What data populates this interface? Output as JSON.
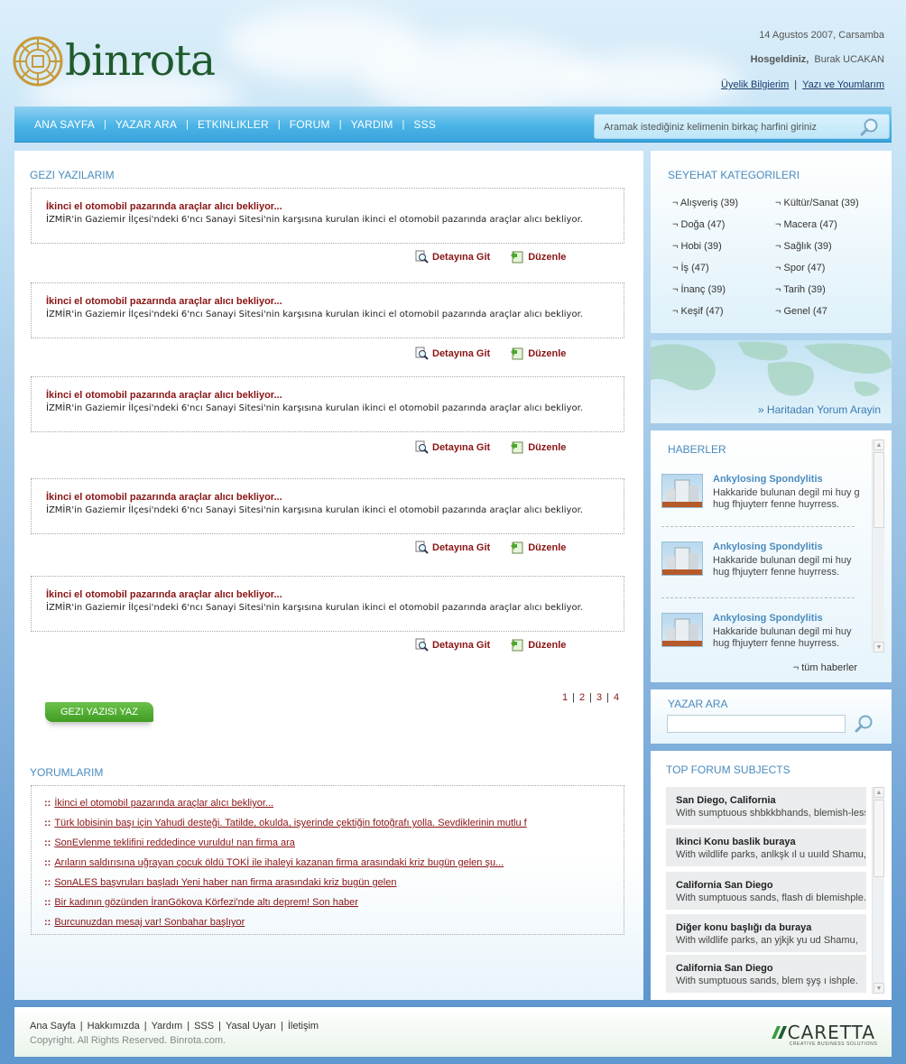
{
  "header": {
    "brand": "binrota",
    "date": "14 Agustos 2007, Carsamba",
    "welcome_label": "Hosgeldiniz,",
    "user_name": "Burak UCAKAN",
    "account_link": "Üyelik Bilgierim",
    "posts_link": "Yazı ve Youmlarım"
  },
  "nav": {
    "items": [
      "ANA SAYFA",
      "YAZAR ARA",
      "ETKINLIKLER",
      "FORUM",
      "YARDIM",
      "SSS"
    ],
    "search_placeholder": "Aramak istediğiniz kelimenin birkaç harfini giriniz"
  },
  "main": {
    "title": "GEZI YAZILARIM",
    "posts": [
      {
        "title": "İkinci el otomobil pazarında araçlar alıcı bekliyor...",
        "body": "İZMİR'in Gaziemir İlçesi'ndeki 6'ncı Sanayi Sitesi'nin karşısına kurulan ikinci el otomobil pazarında araçlar alıcı bekliyor."
      },
      {
        "title": "İkinci el otomobil pazarında araçlar alıcı bekliyor...",
        "body": "İZMİR'in Gaziemir İlçesi'ndeki 6'ncı Sanayi Sitesi'nin karşısına kurulan ikinci el otomobil pazarında araçlar alıcı bekliyor."
      },
      {
        "title": "İkinci el otomobil pazarında araçlar alıcı bekliyor...",
        "body": "İZMİR'in Gaziemir İlçesi'ndeki 6'ncı Sanayi Sitesi'nin karşısına kurulan ikinci el otomobil pazarında araçlar alıcı bekliyor."
      },
      {
        "title": "İkinci el otomobil pazarında araçlar alıcı bekliyor...",
        "body": "İZMİR'in Gaziemir İlçesi'ndeki 6'ncı Sanayi Sitesi'nin karşısına kurulan ikinci el otomobil pazarında araçlar alıcı bekliyor."
      },
      {
        "title": "İkinci el otomobil pazarında araçlar alıcı bekliyor...",
        "body": "İZMİR'in Gaziemir İlçesi'ndeki 6'ncı Sanayi Sitesi'nin karşısına kurulan ikinci el otomobil pazarında araçlar alıcı bekliyor."
      }
    ],
    "detail_label": "Detayına Git",
    "edit_label": "Düzenle",
    "pages": [
      "1",
      "2",
      "3",
      "4"
    ],
    "write_button": "GEZI YAZISI YAZ",
    "comments_title": "YORUMLARIM",
    "comment_bullet": "::",
    "comments": [
      "İkinci el otomobil pazarında araçlar alıcı bekliyor...",
      "Türk lobisinin başı için Yahudi desteği. Tatilde, okulda, işyerinde çektiğin fotoğrafı yolla. Sevdiklerinin mutlu f",
      "SonEvlenme teklifini reddedince vuruldu!  nan firma ara",
      "Arıların saldırısına uğrayan çocuk öldü  TOKİ ile ihaleyi kazanan firma arasındaki kriz bugün gelen şu...",
      "SonALES başvruları başladı Yeni haber nan firma arasındaki kriz bugün gelen",
      "Bir kadının gözünden İranGökova Körfezi'nde altı deprem! Son haber",
      "Burcunuzdan mesaj var! Sonbahar başlıyor"
    ]
  },
  "categories": {
    "title": "SEYEHAT KATEGORILERI",
    "marker": "¬",
    "left": [
      "Alışveriş  (39)",
      "Doğa (47)",
      "Hobi (39)",
      "İş (47)",
      "İnanç (39)",
      "Keşif (47)"
    ],
    "right": [
      "Kültür/Sanat (39)",
      "Macera (47)",
      "Sağlık (39)",
      "Spor (47)",
      "Tarih (39)",
      "Genel (47"
    ]
  },
  "map": {
    "link": "» Haritadan Yorum Arayin"
  },
  "news": {
    "title": "HABERLER",
    "items": [
      {
        "title": "Ankylosing Spondylitis",
        "body": "Hakkaride bulunan degil mi huy g hug fhjuyterr fenne huyrress."
      },
      {
        "title": "Ankylosing Spondylitis",
        "body": "Hakkaride bulunan degil mi huy hug fhjuyterr fenne huyrress."
      },
      {
        "title": "Ankylosing Spondylitis",
        "body": "Hakkaride bulunan degil mi huy hug fhjuyterr fenne huyrress."
      }
    ],
    "all_link": "¬ tüm haberler"
  },
  "author_search": {
    "title": "YAZAR ARA",
    "placeholder": ""
  },
  "forum": {
    "title": "TOP FORUM SUBJECTS",
    "items": [
      {
        "title": "San Diego, California",
        "body": "With sumptuous shbkkbhands, blemish-less"
      },
      {
        "title": "Ikinci Konu baslik buraya",
        "body": "With wildlife parks, anlkşk ıl u  uuıld Shamu,"
      },
      {
        "title": "California San Diego",
        "body": "With sumptuous sands, flash di blemishple."
      },
      {
        "title": "Diğer konu başlığı da buraya",
        "body": "With wildlife parks, an yjkjk yu  ud Shamu,"
      },
      {
        "title": "California San Diego",
        "body": "With sumptuous sands, blem şyş ı ishple."
      }
    ]
  },
  "footer": {
    "links": [
      "Ana Sayfa",
      "Hakkımızda",
      "Yardım",
      "SSS",
      "Yasal Uyarı",
      "İletişim"
    ],
    "copyright": "Copyright. All Rights Reserved. Binrota.com.",
    "partner": "CARETTA",
    "partner_tagline": "CREATIVE BUSINESS SOLUTIONS"
  },
  "colors": {
    "accent_blue": "#4a8bbd",
    "link_red": "#8a1414",
    "nav_blue": "#3aa4dc",
    "button_green": "#4aa82c"
  }
}
